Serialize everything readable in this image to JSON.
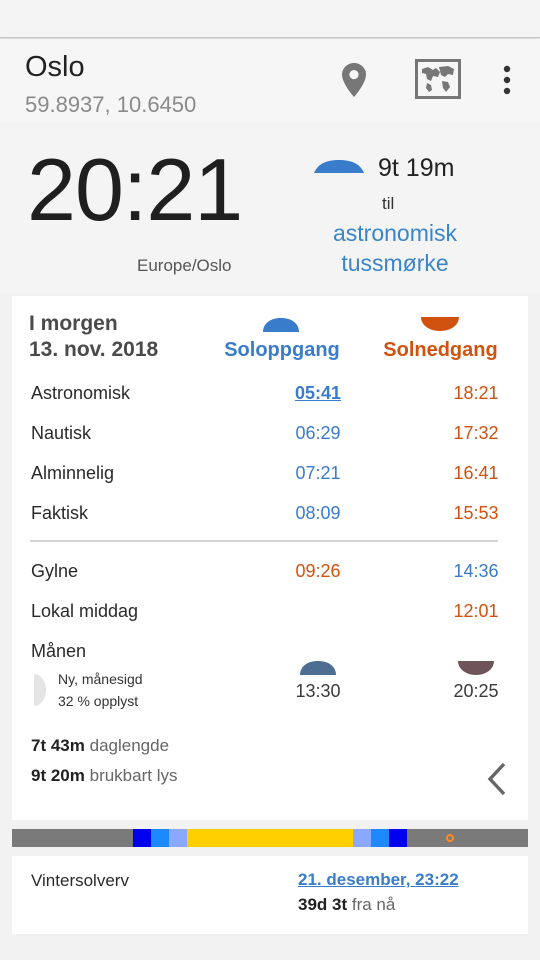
{
  "location": {
    "name": "Oslo",
    "coords": "59.8937, 10.6450"
  },
  "now": {
    "time": "20:21",
    "timezone": "Europe/Oslo",
    "next_duration": "9t 19m",
    "next_til": "til",
    "next_event_line1": "astronomisk",
    "next_event_line2": "tussmørke"
  },
  "day": {
    "label": "I morgen",
    "date": "13. nov. 2018",
    "sunrise_header": "Soloppgang",
    "sunset_header": "Solnedgang",
    "rows": [
      {
        "label": "Astronomisk",
        "rise": "05:41",
        "set": "18:21"
      },
      {
        "label": "Nautisk",
        "rise": "06:29",
        "set": "17:32"
      },
      {
        "label": "Alminnelig",
        "rise": "07:21",
        "set": "16:41"
      },
      {
        "label": "Faktisk",
        "rise": "08:09",
        "set": "15:53"
      }
    ],
    "golden": {
      "label": "Gylne",
      "morning": "09:26",
      "evening": "14:36"
    },
    "noon": {
      "label": "Lokal middag",
      "time": "12:01"
    },
    "moon": {
      "label": "Månen",
      "phase": "Ny, månesigd",
      "illumination": "32 % opplyst",
      "rise": "13:30",
      "set": "20:25"
    },
    "daylength": {
      "value": "7t 43m",
      "label": "daglengde"
    },
    "usable_light": {
      "value": "9t 20m",
      "label": "brukbart lys"
    }
  },
  "timeline": {
    "colors": {
      "night": "#7a7a7a",
      "astronomical": "#0000ee",
      "nautical": "#1e88ff",
      "civil": "#8aa8ff",
      "day": "#ffcf00",
      "now": "#ff8a1e"
    }
  },
  "solstice": {
    "label": "Vintersolverv",
    "date": "21. desember, 23:22",
    "rel_value": "39d 3t",
    "rel_label": "fra nå"
  },
  "colors": {
    "blue": "#3a7ccc",
    "orange": "#d0520e",
    "moon_rise": "#4d6e92",
    "moon_set": "#6e5558"
  },
  "icons": [
    "location-pin-icon",
    "world-map-icon",
    "more-vert-icon",
    "sun-half-icon",
    "moon-phase-icon",
    "chevron-left-icon"
  ]
}
